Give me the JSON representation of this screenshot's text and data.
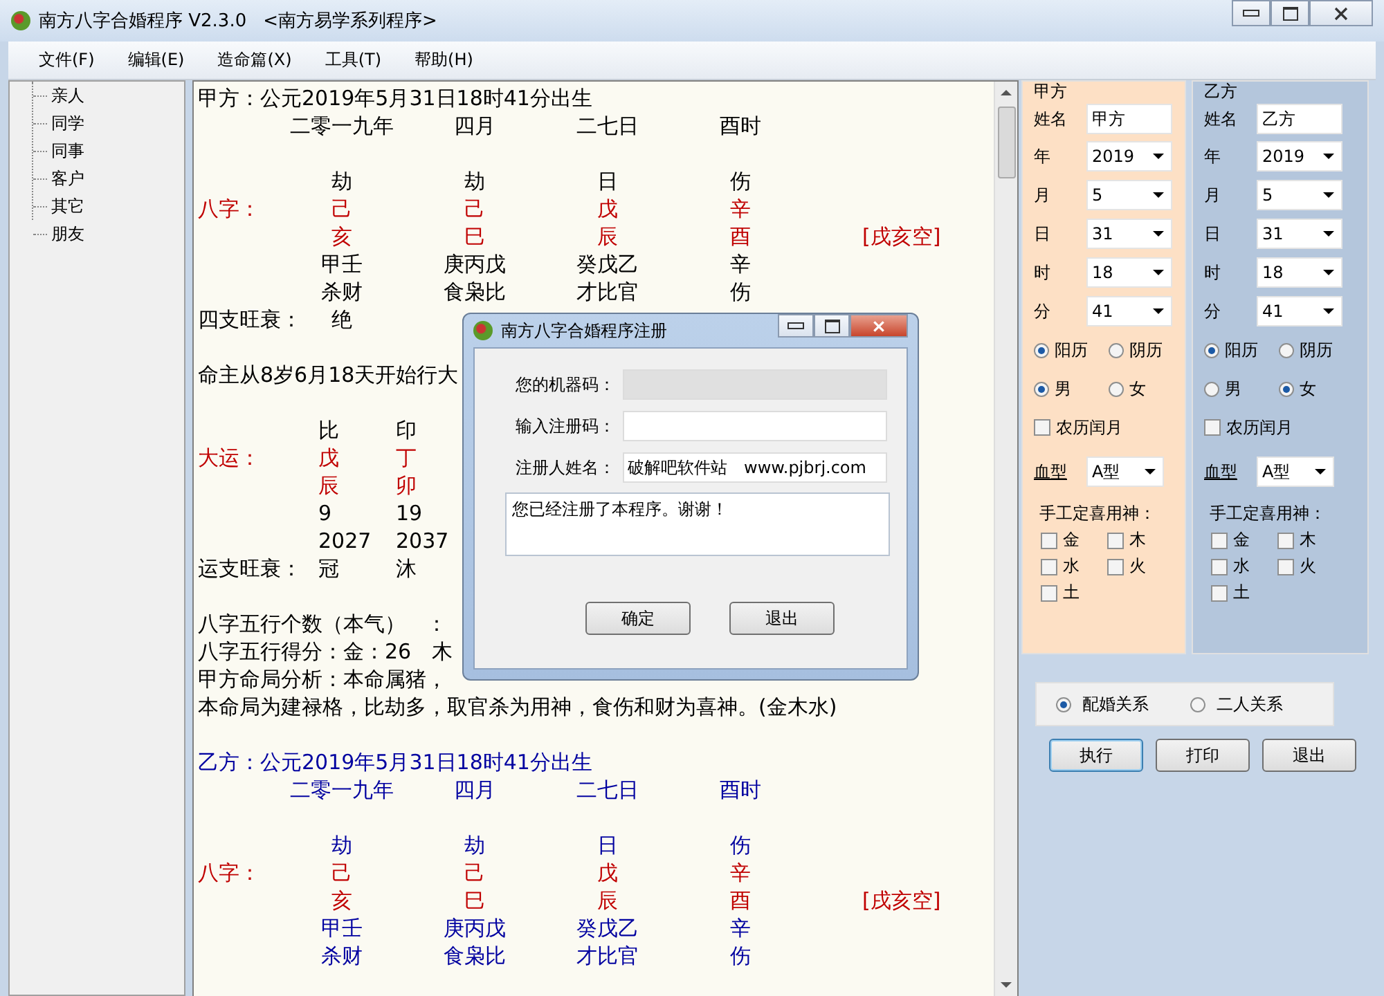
{
  "window": {
    "title": "南方八字合婚程序 V2.3.0",
    "subtitle": "<南方易学系列程序>"
  },
  "menu": [
    "文件(F)",
    "编辑(E)",
    "造命篇(X)",
    "工具(T)",
    "帮助(H)"
  ],
  "tree": [
    "亲人",
    "同学",
    "同事",
    "客户",
    "其它",
    "朋友"
  ],
  "report": [
    {
      "kind": "text",
      "text": "甲方：公元2019年5月31日18时41分出生",
      "color": "#000000"
    },
    {
      "kind": "grid",
      "cells": [
        "二零一九年",
        "四月",
        "二七日",
        "酉时"
      ],
      "color": "#000000"
    },
    {
      "kind": "blank"
    },
    {
      "kind": "grid",
      "cells": [
        "劫",
        "劫",
        "日",
        "伤"
      ],
      "color": "#000000"
    },
    {
      "kind": "grid",
      "label": {
        "text": "八字：",
        "color": "#c00000"
      },
      "cells": [
        "己",
        "己",
        "戊",
        "辛"
      ],
      "color": "#c00000"
    },
    {
      "kind": "grid",
      "cells": [
        "亥",
        "巳",
        "辰",
        "酉"
      ],
      "note": "[戌亥空]",
      "color": "#c00000"
    },
    {
      "kind": "grid",
      "cells": [
        "甲壬",
        "庚丙戊",
        "癸戊乙",
        "辛"
      ],
      "color": "#000000"
    },
    {
      "kind": "grid",
      "cells": [
        "杀财",
        "食枭比",
        "才比官",
        "伤"
      ],
      "color": "#000000"
    },
    {
      "kind": "grid",
      "label": {
        "text": "四支旺衰：",
        "color": "#000000"
      },
      "cells": [
        "绝"
      ],
      "color": "#000000"
    },
    {
      "kind": "blank"
    },
    {
      "kind": "text",
      "text": "命主从8岁6月18天开始行大",
      "color": "#000000"
    },
    {
      "kind": "blank"
    },
    {
      "kind": "dayun",
      "cells": [
        "比",
        "印"
      ],
      "color": "#000000"
    },
    {
      "kind": "dayun",
      "label": {
        "text": "大运：",
        "color": "#c00000"
      },
      "cells": [
        "戊",
        "丁"
      ],
      "color": "#c00000"
    },
    {
      "kind": "dayun",
      "cells": [
        "辰",
        "卯"
      ],
      "color": "#c00000"
    },
    {
      "kind": "dayun",
      "cells": [
        "9",
        "19"
      ],
      "color": "#000000"
    },
    {
      "kind": "dayun",
      "cells": [
        "2027",
        "2037"
      ],
      "color": "#000000"
    },
    {
      "kind": "dayun",
      "label": {
        "text": "运支旺衰：",
        "color": "#000000"
      },
      "cells": [
        "冠",
        "沐"
      ],
      "color": "#000000"
    },
    {
      "kind": "blank"
    },
    {
      "kind": "text",
      "text": "八字五行个数（本气）　：",
      "color": "#000000"
    },
    {
      "kind": "text",
      "text": "八字五行得分：金：26　木",
      "color": "#000000"
    },
    {
      "kind": "text",
      "text": "甲方命局分析：本命属猪，",
      "color": "#000000"
    },
    {
      "kind": "text",
      "text": "本命局为建禄格，比劫多，取官杀为用神，食伤和财为喜神。(金木水)",
      "color": "#000000"
    },
    {
      "kind": "blank"
    },
    {
      "kind": "text",
      "text": "乙方：公元2019年5月31日18时41分出生",
      "color": "#0000a0"
    },
    {
      "kind": "grid",
      "cells": [
        "二零一九年",
        "四月",
        "二七日",
        "酉时"
      ],
      "color": "#0000a0"
    },
    {
      "kind": "blank"
    },
    {
      "kind": "grid",
      "cells": [
        "劫",
        "劫",
        "日",
        "伤"
      ],
      "color": "#0000a0"
    },
    {
      "kind": "grid",
      "label": {
        "text": "八字：",
        "color": "#c00000"
      },
      "cells": [
        "己",
        "己",
        "戊",
        "辛"
      ],
      "color": "#c00000"
    },
    {
      "kind": "grid",
      "cells": [
        "亥",
        "巳",
        "辰",
        "酉"
      ],
      "note": "[戌亥空]",
      "color": "#c00000"
    },
    {
      "kind": "grid",
      "cells": [
        "甲壬",
        "庚丙戊",
        "癸戊乙",
        "辛"
      ],
      "color": "#0000a0"
    },
    {
      "kind": "grid",
      "cells": [
        "杀财",
        "食枭比",
        "才比官",
        "伤"
      ],
      "color": "#0000a0"
    }
  ],
  "parties": [
    {
      "title": "甲方",
      "color": "#fde0c5",
      "name_label": "姓名",
      "name": "甲方",
      "fields": [
        {
          "label": "年",
          "value": "2019"
        },
        {
          "label": "月",
          "value": "5"
        },
        {
          "label": "日",
          "value": "31"
        },
        {
          "label": "时",
          "value": "18"
        },
        {
          "label": "分",
          "value": "41"
        }
      ],
      "calendar": [
        {
          "label": "阳历",
          "selected": true
        },
        {
          "label": "阴历",
          "selected": false
        }
      ],
      "sex": [
        {
          "label": "男",
          "selected": true
        },
        {
          "label": "女",
          "selected": false
        }
      ],
      "leap": {
        "label": "农历闰月",
        "checked": false
      },
      "blood": {
        "label": "血型",
        "value": "A型"
      },
      "elements_title": "手工定喜用神：",
      "elements": [
        {
          "label": "金",
          "checked": false
        },
        {
          "label": "木",
          "checked": false
        },
        {
          "label": "水",
          "checked": false
        },
        {
          "label": "火",
          "checked": false
        },
        {
          "label": "土",
          "checked": false
        }
      ]
    },
    {
      "title": "乙方",
      "color": "#b4c6dc",
      "name_label": "姓名",
      "name": "乙方",
      "fields": [
        {
          "label": "年",
          "value": "2019"
        },
        {
          "label": "月",
          "value": "5"
        },
        {
          "label": "日",
          "value": "31"
        },
        {
          "label": "时",
          "value": "18"
        },
        {
          "label": "分",
          "value": "41"
        }
      ],
      "calendar": [
        {
          "label": "阳历",
          "selected": true
        },
        {
          "label": "阴历",
          "selected": false
        }
      ],
      "sex": [
        {
          "label": "男",
          "selected": false
        },
        {
          "label": "女",
          "selected": true
        }
      ],
      "leap": {
        "label": "农历闰月",
        "checked": false
      },
      "blood": {
        "label": "血型",
        "value": "A型"
      },
      "elements_title": "手工定喜用神：",
      "elements": [
        {
          "label": "金",
          "checked": false
        },
        {
          "label": "木",
          "checked": false
        },
        {
          "label": "水",
          "checked": false
        },
        {
          "label": "火",
          "checked": false
        },
        {
          "label": "土",
          "checked": false
        }
      ]
    }
  ],
  "relation": [
    {
      "label": "配婚关系",
      "selected": true
    },
    {
      "label": "二人关系",
      "selected": false
    }
  ],
  "actions": [
    {
      "label": "执行",
      "focused": true
    },
    {
      "label": "打印",
      "focused": false
    },
    {
      "label": "退出",
      "focused": false
    }
  ],
  "dialog": {
    "title": "南方八字合婚程序注册",
    "fields": [
      {
        "label": "您的机器码：",
        "disabled": true
      },
      {
        "label": "输入注册码：",
        "disabled": false
      },
      {
        "label": "注册人姓名：",
        "value": "破解吧软件站　www.pjbrj.com",
        "disabled": false
      }
    ],
    "message": "您已经注册了本程序。谢谢！",
    "buttons": [
      "确定",
      "退出"
    ]
  }
}
